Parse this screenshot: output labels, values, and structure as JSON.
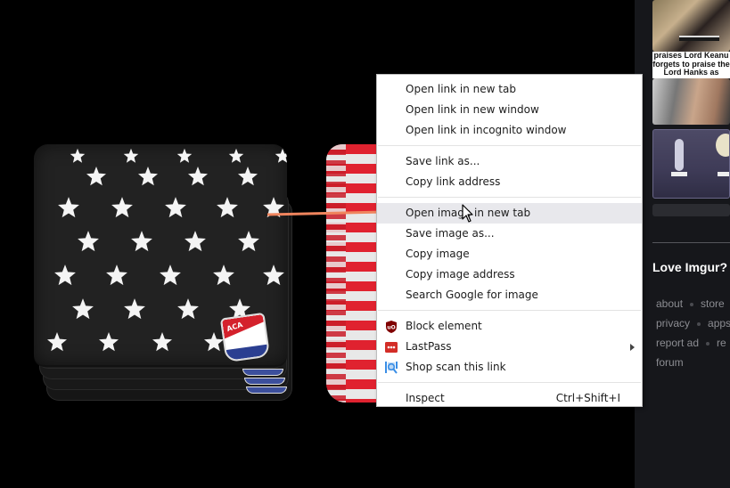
{
  "canvas": {
    "background": "#000000",
    "images": [
      {
        "name": "black-star-cornhole-bags",
        "description": "Stack of black cornhole bags with white stars",
        "logo_text": "ACA"
      },
      {
        "name": "red-white-striped-cornhole-bags",
        "description": "Stack of red and white striped cornhole bags"
      }
    ],
    "annotation_arrow_color": "#f0855e"
  },
  "context_menu": {
    "groups": [
      [
        {
          "label": "Open link in new tab"
        },
        {
          "label": "Open link in new window"
        },
        {
          "label": "Open link in incognito window"
        }
      ],
      [
        {
          "label": "Save link as..."
        },
        {
          "label": "Copy link address"
        }
      ],
      [
        {
          "label": "Open image in new tab",
          "hovered": true
        },
        {
          "label": "Save image as..."
        },
        {
          "label": "Copy image"
        },
        {
          "label": "Copy image address"
        },
        {
          "label": "Search Google for image"
        }
      ],
      [
        {
          "label": "Block element",
          "icon": "ublock-origin-icon",
          "icon_color": "#800000",
          "icon_text": "uO"
        },
        {
          "label": "LastPass",
          "icon": "lastpass-icon",
          "icon_color": "#d32d27",
          "has_submenu": true
        },
        {
          "label": "Shop scan this link",
          "icon": "shop-scan-icon",
          "icon_color": "#3a8ee6"
        }
      ],
      [
        {
          "label": "Inspect",
          "shortcut": "Ctrl+Shift+I"
        }
      ]
    ],
    "hover_color": "#e8e8ec"
  },
  "sidebar": {
    "background": "#16171b",
    "thumbnails": [
      {
        "name": "thumbnail-meme-1",
        "caption_lines": [
          "praises Lord Keanu",
          "forgets to praise the",
          "Lord Hanks as"
        ]
      },
      {
        "name": "thumbnail-meme-2"
      },
      {
        "name": "thumbnail-meme-3"
      },
      {
        "name": "thumbnail-meme-4"
      }
    ],
    "love_title": "Love Imgur?",
    "footer_links": [
      [
        "about",
        "store"
      ],
      [
        "privacy",
        "apps"
      ],
      [
        "report ad",
        "re"
      ],
      [
        "forum"
      ]
    ]
  }
}
